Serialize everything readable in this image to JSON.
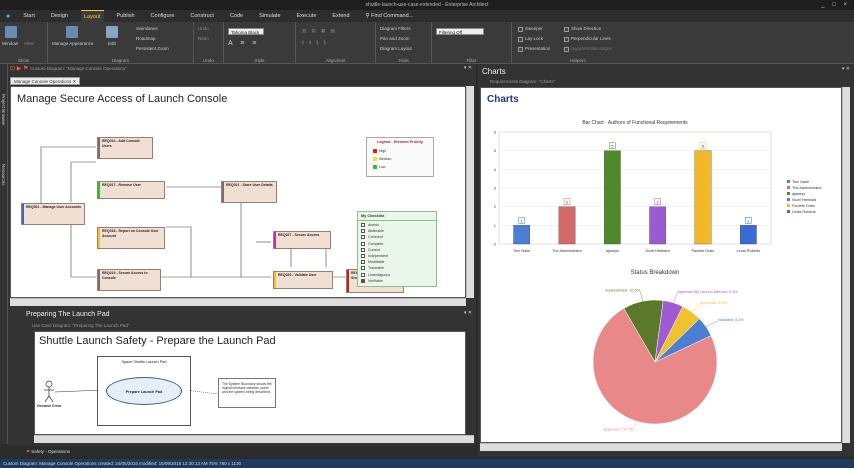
{
  "window": {
    "title": "shuttle-launch-use-case-extended - Enterprise Architect",
    "controls": "_ □ ×"
  },
  "menu": {
    "items": [
      "Start",
      "Design",
      "Layout",
      "Publish",
      "Configure",
      "Construct",
      "Code",
      "Simulate",
      "Execute",
      "Extend"
    ],
    "active": "Layout",
    "search": "Find Command..."
  },
  "ribbon": {
    "groups": {
      "show": "Show",
      "diagram": "Diagram",
      "undo": "Undo",
      "style": "Style",
      "alignment": "Alignment",
      "tools": "Tools",
      "filter": "Filter",
      "helpers": "Helpers"
    },
    "buttons": {
      "window": "Window",
      "view": "View",
      "manage_appearance": "Manage Appearance",
      "edit": "Edit",
      "swimlanes": "Swimlanes",
      "roadmap": "Roadmap",
      "persistent_zoom": "Persistent Zoom",
      "undo": "Undo",
      "redo": "Redo",
      "diagram_filters": "Diagram Filters",
      "pan_zoom": "Pan and Zoom",
      "diagram_layout": "Diagram Layout"
    },
    "font_value": "Tahoma Black",
    "filter_value": "Filtering Off",
    "helpers": {
      "sweeper": "Sweeper",
      "show_direction": "Show Direction",
      "lay_lock": "Lay Lock",
      "perpendicular_lines": "Perpendicular Lines",
      "presentation": "Presentation",
      "suppress_messages": "Suppress Messages"
    }
  },
  "sidebar": {
    "tabs": [
      "Project Browser",
      "Resources"
    ]
  },
  "main_diagram": {
    "breadcrumb": "Custom Diagram: \"Manage Console Operations\"",
    "tab": "Manage Console Operations",
    "title": "Manage Secure Access of Launch Console",
    "requirements": [
      {
        "id": "r14",
        "label": "REQ014 - Add Console Users",
        "color": "#7a6f6f"
      },
      {
        "id": "r17",
        "label": "REQ017 - Remove User",
        "color": "#2fc12f"
      },
      {
        "id": "r21",
        "label": "REQ021 - Store User Details",
        "color": "#7a6f6f"
      },
      {
        "id": "r01",
        "label": "REQ001 - Manage User Accounts",
        "color": "#3b64c4"
      },
      {
        "id": "r18",
        "label": "REQ018 - Report on Console User Account",
        "color": "#f2c12f"
      },
      {
        "id": "r27",
        "label": "REQ027 - Secure Access",
        "color": "#c02fc0"
      },
      {
        "id": "r19",
        "label": "REQ019 - Secure Access to Console",
        "color": "#7a6f6f"
      },
      {
        "id": "r20",
        "label": "REQ020 - Validate User",
        "color": "#f2c12f"
      },
      {
        "id": "r77",
        "label": "REQ777 - Console Operator Short Base Security Overview",
        "color": "#c01f1f"
      }
    ],
    "legend": {
      "title": "Legend - Element Priority",
      "items": [
        {
          "label": "High",
          "color": "#e02020"
        },
        {
          "label": "Medium",
          "color": "#f2e020"
        },
        {
          "label": "Low",
          "color": "#30c030"
        }
      ]
    },
    "checklist": {
      "title": "My Checklist",
      "items": [
        "Atomic",
        "Attainable",
        "Coherent",
        "Complete",
        "Current",
        "Independent",
        "Modifiable",
        "Traceable",
        "Unambiguous",
        "Verifiable"
      ]
    }
  },
  "bottom_diagram": {
    "panel_title": "Preparing The Launch Pad",
    "breadcrumb": "Use Case Diagram: \"Preparing The Launch Pad\"",
    "title": "Shuttle Launch Safety - Prepare the Launch Pad",
    "boundary": "Space Shuttle Launch Pad",
    "usecase": "Prepare Launch Pad",
    "actor": "Ground Crew",
    "note": "The System Boundary shows the logical interface between users and the system being described."
  },
  "charts_panel": {
    "panel_title": "Charts",
    "breadcrumb": "Requirements Diagram: \"Charts\"",
    "heading": "Charts",
    "bottom_tab": "Safety - Operations"
  },
  "chart_data": [
    {
      "type": "bar",
      "title": "Bar Chart - Authors of Functional Requirements",
      "categories": [
        "Tom Nake",
        "The Administrator",
        "ajaneys",
        "Scott Hebbard",
        "Paolete Drain",
        "Linda Roberts"
      ],
      "values": [
        1,
        2,
        5,
        2,
        5,
        1
      ],
      "colors": [
        "#4a7fd4",
        "#d46a6a",
        "#4e8a2a",
        "#9a5ad4",
        "#f2b82a",
        "#3a6ad4"
      ],
      "legend": [
        "Tom Nake",
        "The Administrator",
        "ajaneys",
        "Scott Hebbard",
        "Paolete Drain",
        "Linda Roberts"
      ],
      "ylim": [
        0,
        6
      ],
      "yticks": [
        0,
        1,
        2,
        3,
        4,
        5,
        6
      ]
    },
    {
      "type": "pie",
      "title": "Status Breakdown",
      "slices": [
        {
          "label": "Approved",
          "value": 73.7,
          "color": "#e88888"
        },
        {
          "label": "Implemented",
          "value": 10.5,
          "color": "#5a7a2a"
        },
        {
          "label": "Approved By Launch Director",
          "value": 5.3,
          "color": "#a05ad4"
        },
        {
          "label": "Approved",
          "value": 5.3,
          "color": "#f2c12f"
        },
        {
          "label": "Validated",
          "value": 5.3,
          "color": "#4a7fd4"
        }
      ],
      "labels_text": [
        "Approved: 73.7%",
        "Implemented: 10.5%",
        "Approved By Launch Director: 5.3%",
        "Approved: 5.3%",
        "Validated: 5.3%"
      ]
    }
  ],
  "status": {
    "text": "Custom Diagram: Manage Console Operations  created: 24/05/2016  modified: 15/09/2016 12:30:13 AM  75%  780 x 1130"
  }
}
